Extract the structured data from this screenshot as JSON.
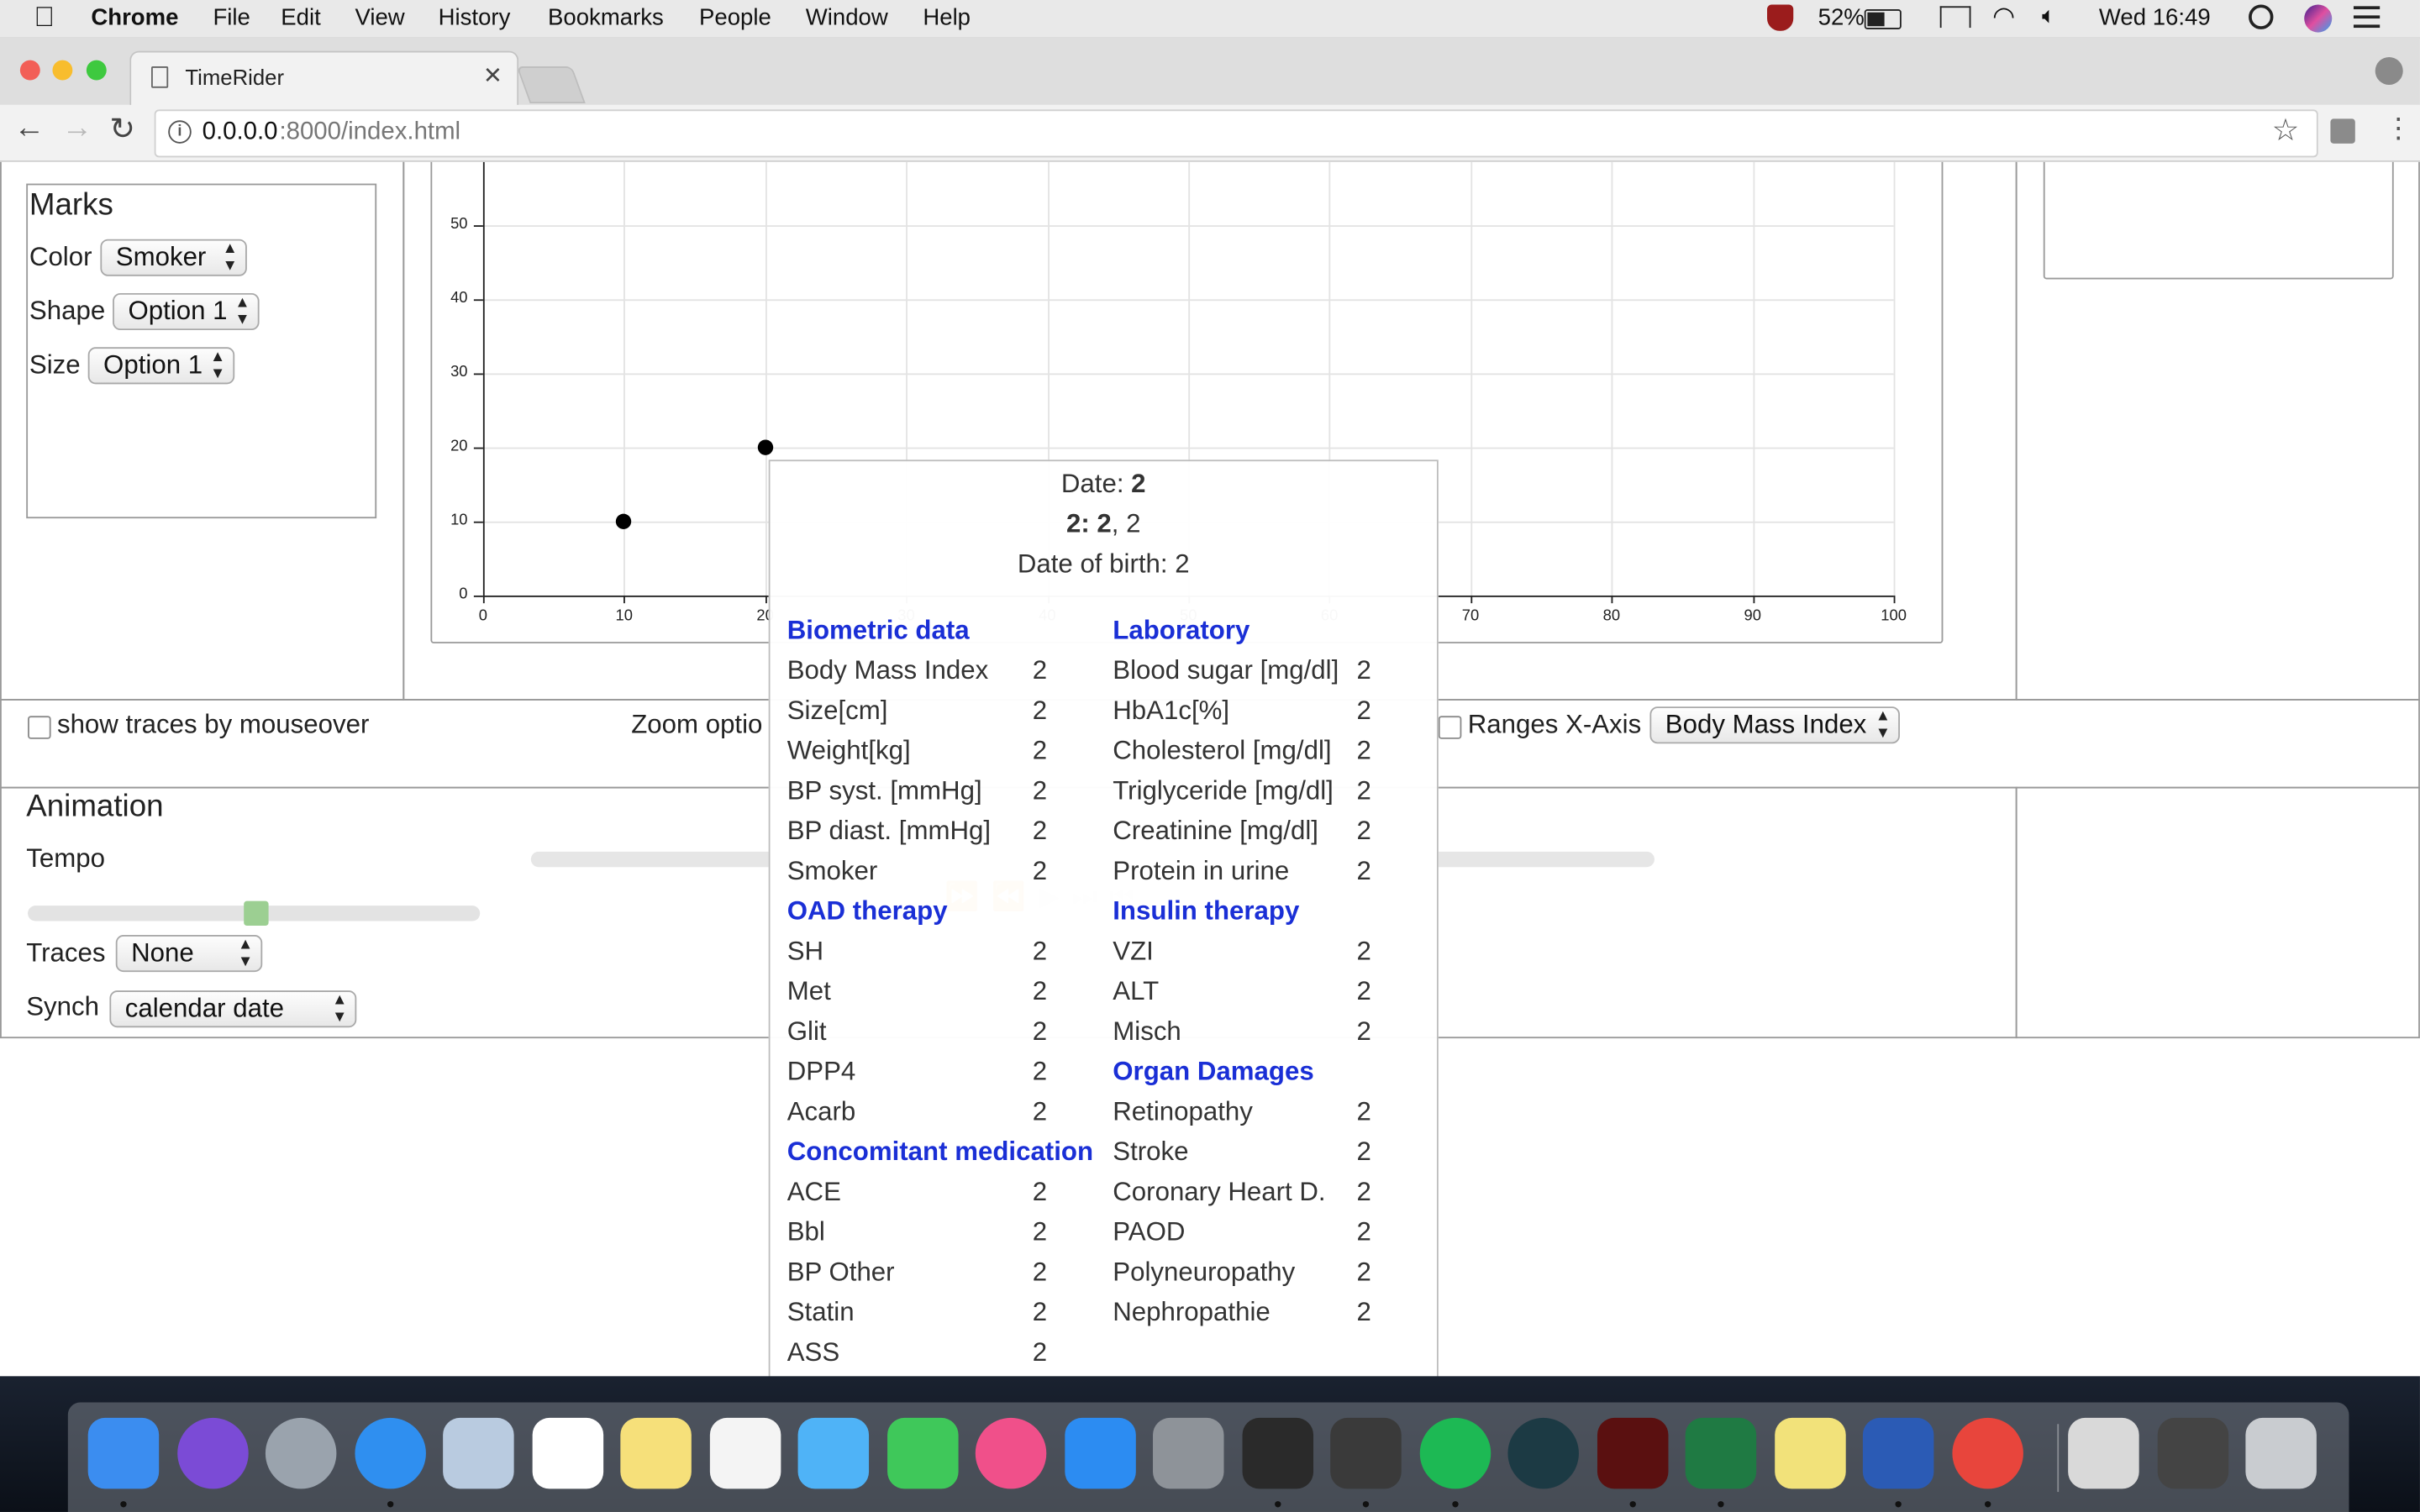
{
  "menubar": {
    "app": "Chrome",
    "items": [
      "File",
      "Edit",
      "View",
      "History",
      "Bookmarks",
      "People",
      "Window",
      "Help"
    ],
    "battery": "52%",
    "clock": "Wed 16:49"
  },
  "tab": {
    "title": "TimeRider"
  },
  "address": {
    "host": "0.0.0.0",
    "path": ":8000/index.html"
  },
  "marks": {
    "title": "Marks",
    "color_label": "Color",
    "color_value": "Smoker",
    "shape_label": "Shape",
    "shape_value": "Option 1",
    "size_label": "Size",
    "size_value": "Option 1"
  },
  "chart_data": {
    "type": "scatter",
    "x": [
      10,
      20
    ],
    "y": [
      10,
      20
    ],
    "xticks": [
      "0",
      "10",
      "20",
      "30",
      "40",
      "50",
      "60",
      "70",
      "80",
      "90",
      "100"
    ],
    "yticks": [
      "0",
      "10",
      "20",
      "30",
      "40",
      "50"
    ],
    "xlim": [
      0,
      100
    ],
    "ylim": [
      0,
      50
    ],
    "grid": true
  },
  "options": {
    "traces_checkbox": "show traces by mouseover",
    "zoom_label": "Zoom optio",
    "ranges_label": "Ranges X-Axis",
    "ranges_value": "Body Mass Index"
  },
  "animation": {
    "title": "Animation",
    "tempo_label": "Tempo",
    "tempo_level": 0.5,
    "traces_label": "Traces",
    "traces_value": "None",
    "synch_label": "Synch",
    "synch_value": "calendar date"
  },
  "tooltip": {
    "date_label": "Date: ",
    "date_value": "2",
    "line2_bold": "2: 2",
    "line2_rest": ", 2",
    "birth": "Date of birth: 2",
    "left": [
      {
        "h": "Biometric data"
      },
      {
        "k": "Body Mass Index",
        "v": "2"
      },
      {
        "k": "Size[cm]",
        "v": "2"
      },
      {
        "k": "Weight[kg]",
        "v": "2"
      },
      {
        "k": "BP syst. [mmHg]",
        "v": "2"
      },
      {
        "k": "BP diast. [mmHg]",
        "v": "2"
      },
      {
        "k": "Smoker",
        "v": "2"
      },
      {
        "h": "OAD therapy"
      },
      {
        "k": "SH",
        "v": "2"
      },
      {
        "k": "Met",
        "v": "2"
      },
      {
        "k": "Glit",
        "v": "2"
      },
      {
        "k": "DPP4",
        "v": "2"
      },
      {
        "k": "Acarb",
        "v": "2"
      },
      {
        "h": "Concomitant medication"
      },
      {
        "k": "ACE",
        "v": "2"
      },
      {
        "k": "Bbl",
        "v": "2"
      },
      {
        "k": "BP Other",
        "v": "2"
      },
      {
        "k": "Statin",
        "v": "2"
      },
      {
        "k": "ASS",
        "v": "2"
      }
    ],
    "right": [
      {
        "h": "Laboratory"
      },
      {
        "k": "Blood sugar [mg/dl]",
        "v": "2"
      },
      {
        "k": "HbA1c[%]",
        "v": "2"
      },
      {
        "k": "Cholesterol [mg/dl]",
        "v": "2"
      },
      {
        "k": "Triglyceride [mg/dl]",
        "v": "2"
      },
      {
        "k": "Creatinine [mg/dl]",
        "v": "2"
      },
      {
        "k": "Protein in urine",
        "v": "2"
      },
      {
        "h": "Insulin therapy"
      },
      {
        "k": "VZI",
        "v": "2"
      },
      {
        "k": "ALT",
        "v": "2"
      },
      {
        "k": "Misch",
        "v": "2"
      },
      {
        "h": "Organ Damages"
      },
      {
        "k": "Retinopathy",
        "v": "2"
      },
      {
        "k": "Stroke",
        "v": "2"
      },
      {
        "k": "Coronary Heart D.",
        "v": "2"
      },
      {
        "k": "PAOD",
        "v": "2"
      },
      {
        "k": "Polyneuropathy",
        "v": "2"
      },
      {
        "k": "Nephropathie",
        "v": "2"
      }
    ]
  },
  "dock": {
    "icons": [
      {
        "name": "finder-icon",
        "color": "#3b8df0"
      },
      {
        "name": "siri-icon",
        "color": "#7b4bd6"
      },
      {
        "name": "launchpad-icon",
        "color": "#9aa3ad"
      },
      {
        "name": "safari-icon",
        "color": "#2f8ff0"
      },
      {
        "name": "mail-icon",
        "color": "#b9cbe0"
      },
      {
        "name": "calendar-icon",
        "color": "#ffffff"
      },
      {
        "name": "notes-icon",
        "color": "#f6e07a"
      },
      {
        "name": "reminders-icon",
        "color": "#f4f4f4"
      },
      {
        "name": "messages-icon",
        "color": "#4fb3f7"
      },
      {
        "name": "facetime-icon",
        "color": "#3fc85a"
      },
      {
        "name": "itunes-icon",
        "color": "#f0508a"
      },
      {
        "name": "appstore-icon",
        "color": "#2c8cf2"
      },
      {
        "name": "system-preferences-icon",
        "color": "#8e9399"
      },
      {
        "name": "terminal-icon",
        "color": "#2a2a2a"
      },
      {
        "name": "sublime-icon",
        "color": "#3a3a3a"
      },
      {
        "name": "spotify-icon",
        "color": "#1db954"
      },
      {
        "name": "gitkraken-icon",
        "color": "#1c3a44"
      },
      {
        "name": "acrobat-icon",
        "color": "#5a1010"
      },
      {
        "name": "excel-icon",
        "color": "#1f7a43"
      },
      {
        "name": "stickies-icon",
        "color": "#f2e27a"
      },
      {
        "name": "word-icon",
        "color": "#2b5bb5"
      },
      {
        "name": "chrome-icon",
        "color": "#e8453c"
      },
      {
        "name": "downloads-icon",
        "color": "#d9d9d9"
      },
      {
        "name": "stack-icon",
        "color": "#444444"
      },
      {
        "name": "trash-icon",
        "color": "#c9ccd0"
      }
    ]
  }
}
